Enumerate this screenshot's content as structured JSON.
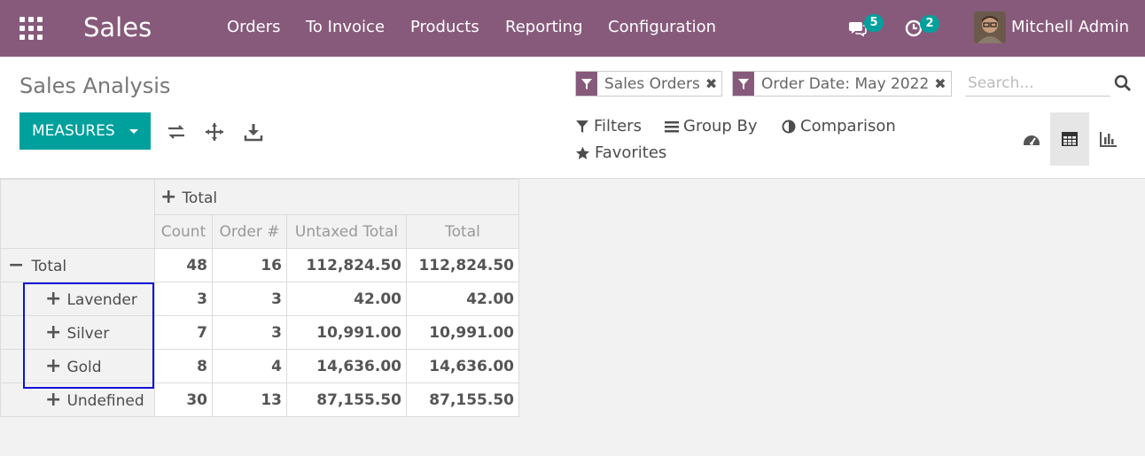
{
  "navbar": {
    "brand": "Sales",
    "menu": [
      "Orders",
      "To Invoice",
      "Products",
      "Reporting",
      "Configuration"
    ],
    "messages_count": "5",
    "activities_count": "2",
    "user_name": "Mitchell Admin",
    "color": "#875a7b"
  },
  "control_panel": {
    "title": "Sales Analysis",
    "measures_label": "MEASURES",
    "facets": [
      "Sales Orders",
      "Order Date: May 2022"
    ],
    "search_placeholder": "Search...",
    "filters_label": "Filters",
    "group_by_label": "Group By",
    "comparison_label": "Comparison",
    "favorites_label": "Favorites",
    "accent": "#00a09d"
  },
  "pivot": {
    "col_group": "Total",
    "measures": [
      "Count",
      "Order #",
      "Untaxed Total",
      "Total"
    ],
    "total_row": {
      "label": "Total",
      "values": [
        "48",
        "16",
        "112,824.50",
        "112,824.50"
      ]
    },
    "rows": [
      {
        "label": "Lavender",
        "values": [
          "3",
          "3",
          "42.00",
          "42.00"
        ]
      },
      {
        "label": "Silver",
        "values": [
          "7",
          "3",
          "10,991.00",
          "10,991.00"
        ]
      },
      {
        "label": "Gold",
        "values": [
          "8",
          "4",
          "14,636.00",
          "14,636.00"
        ]
      },
      {
        "label": "Undefined",
        "values": [
          "30",
          "13",
          "87,155.50",
          "87,155.50"
        ]
      }
    ]
  }
}
